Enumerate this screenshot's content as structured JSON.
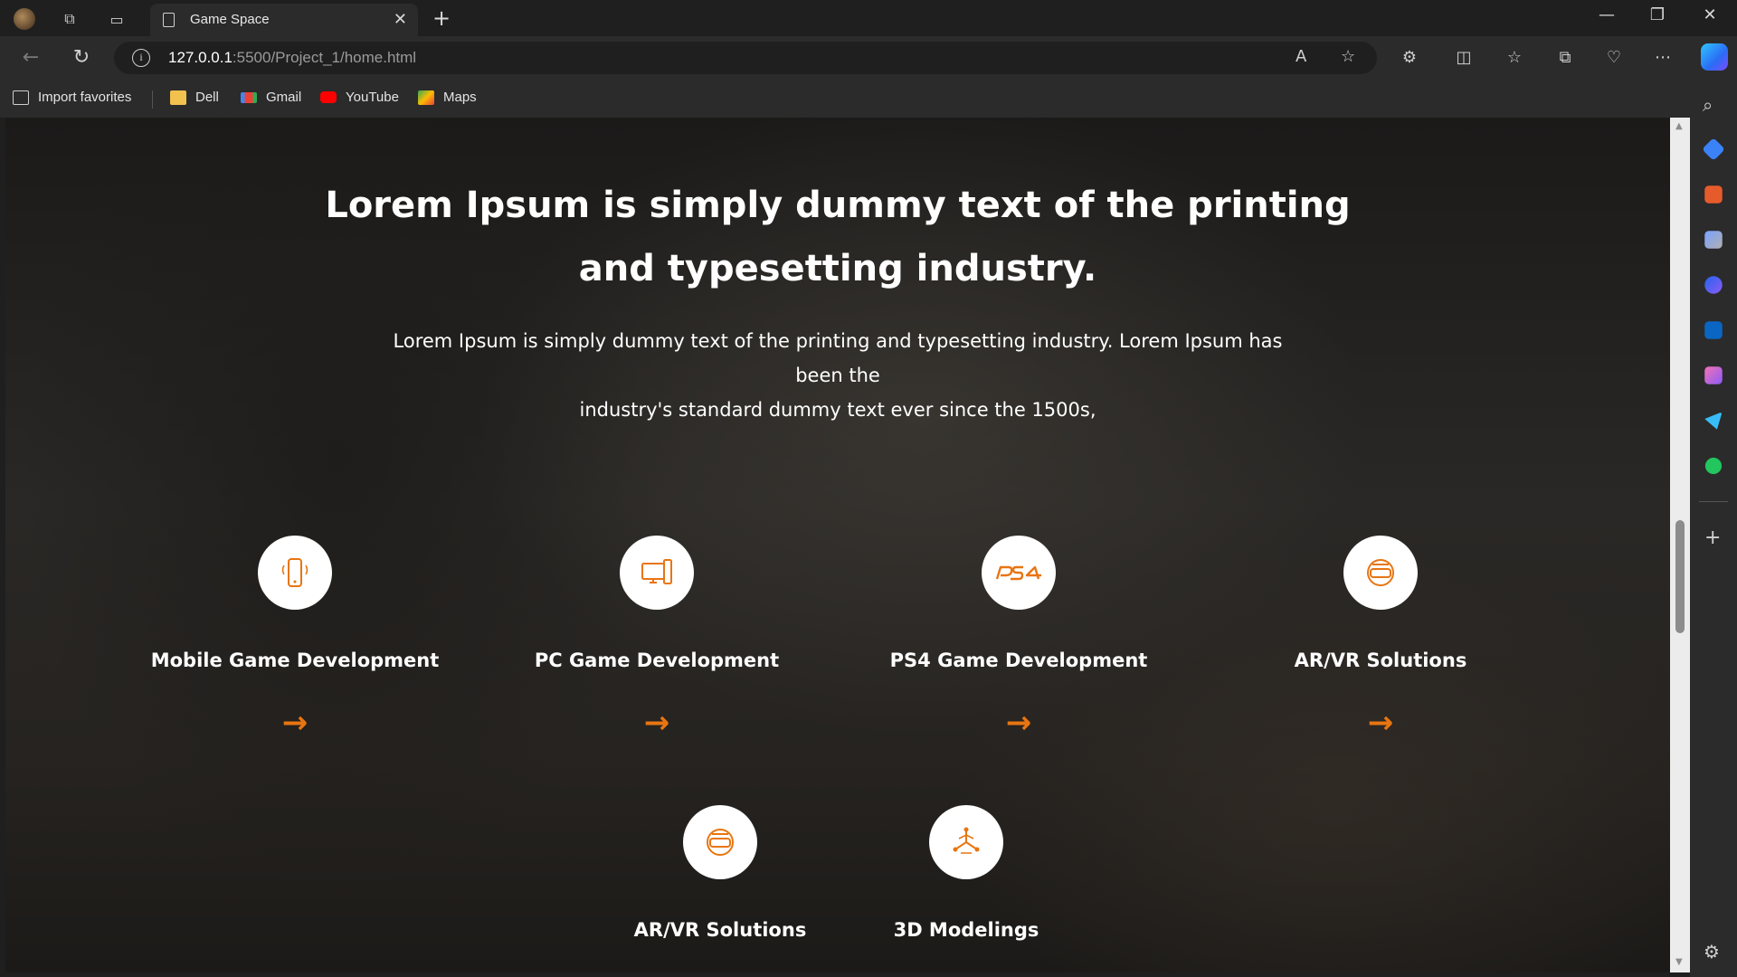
{
  "browser": {
    "tab_title": "Game Space",
    "url_host": "127.0.0.1",
    "url_path": ":5500/Project_1/home.html",
    "bookmarks": [
      {
        "label": "Import favorites",
        "icon": "import-icon"
      },
      {
        "label": "Dell",
        "icon": "folder-icon"
      },
      {
        "label": "Gmail",
        "icon": "gmail-icon"
      },
      {
        "label": "YouTube",
        "icon": "youtube-icon"
      },
      {
        "label": "Maps",
        "icon": "maps-icon"
      }
    ]
  },
  "hero": {
    "title_line1": "Lorem Ipsum is simply dummy text of the printing",
    "title_line2": "and typesetting industry.",
    "description_line1": "Lorem Ipsum is simply dummy text of the printing and typesetting industry. Lorem Ipsum has been the",
    "description_line2": "industry's standard dummy text ever since the 1500s,"
  },
  "services": [
    {
      "label": "Mobile Game Development",
      "icon": "mobile-icon",
      "arrow": "→"
    },
    {
      "label": "PC Game Development",
      "icon": "pc-icon",
      "arrow": "→"
    },
    {
      "label": "PS4 Game Development",
      "icon": "ps4-icon",
      "arrow": "→"
    },
    {
      "label": "AR/VR Solutions",
      "icon": "vr-headset-icon",
      "arrow": "→"
    },
    {
      "label": "AR/VR Solutions",
      "icon": "vr-headset-icon"
    },
    {
      "label": "3D Modelings",
      "icon": "3d-model-icon"
    }
  ],
  "colors": {
    "accent": "#e87512",
    "text": "#ffffff",
    "chrome_bg": "#2b2b2b"
  }
}
